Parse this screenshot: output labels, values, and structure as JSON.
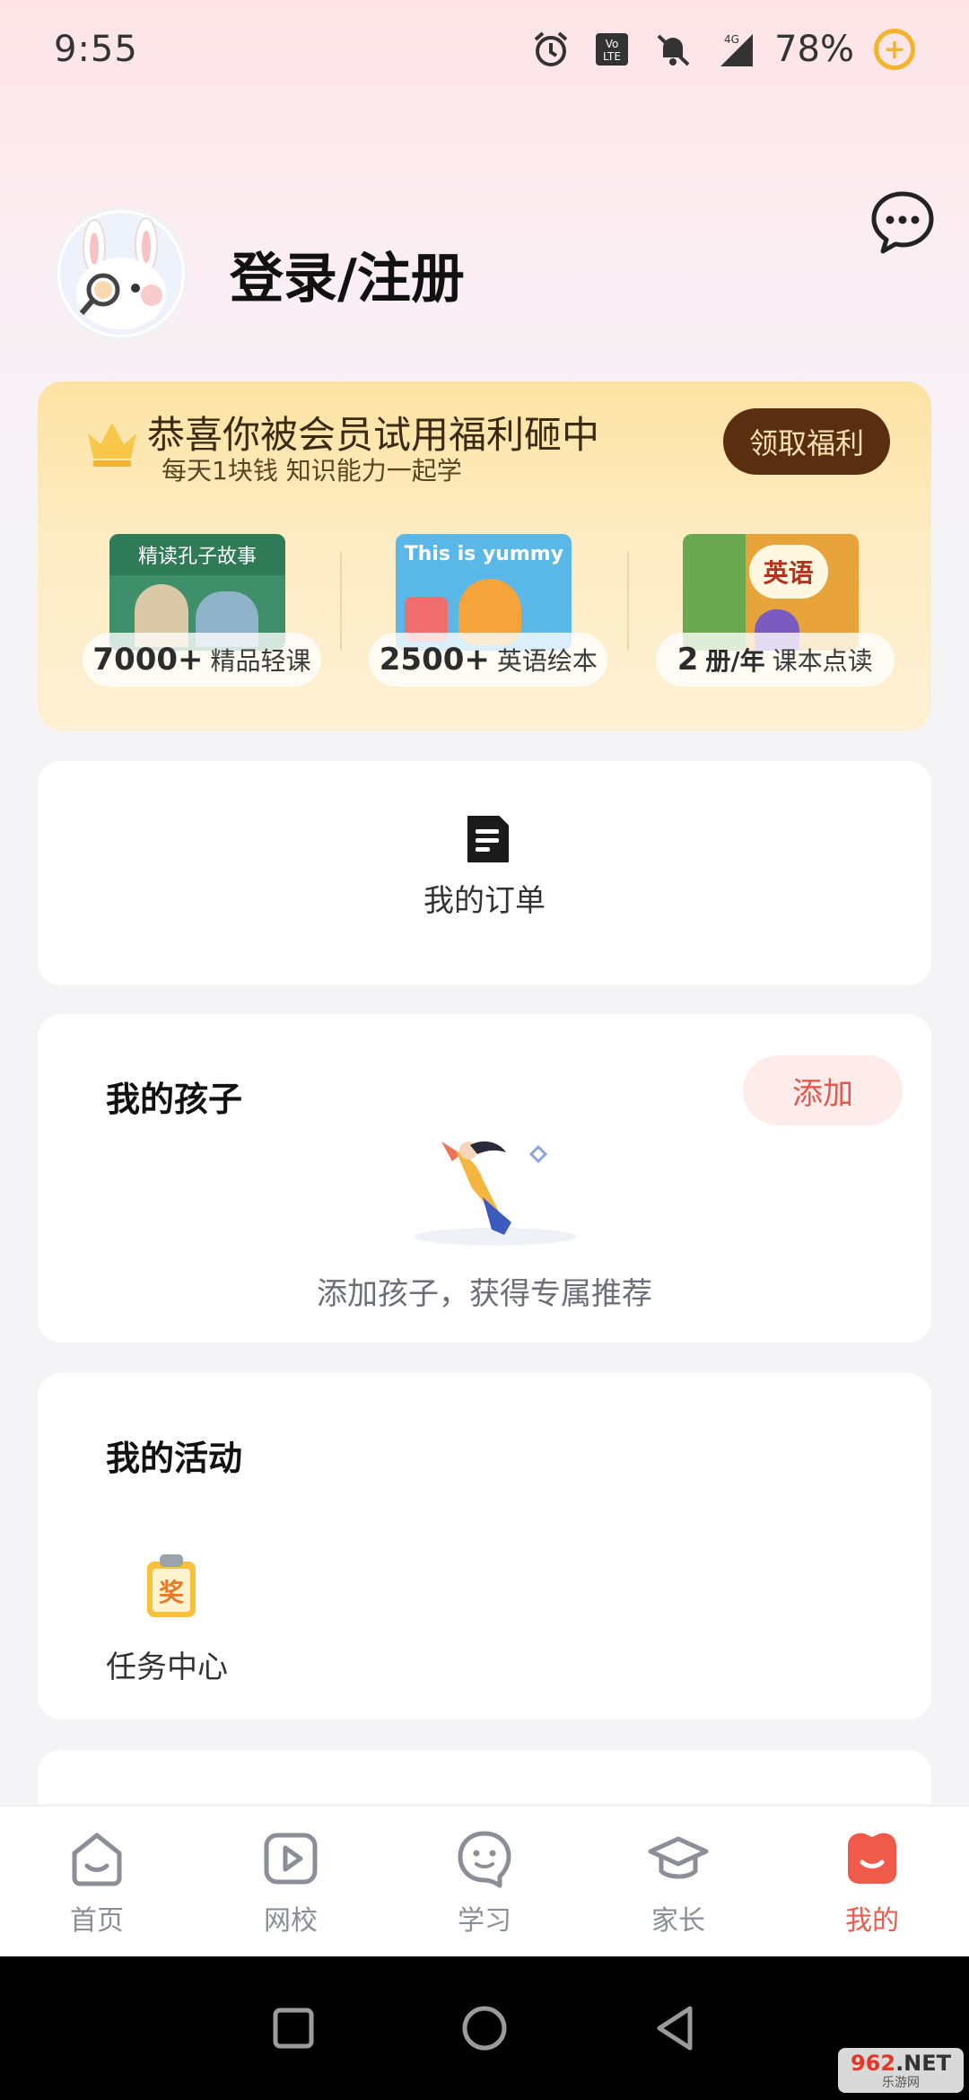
{
  "status_bar": {
    "time": "9:55",
    "battery": "78%",
    "network": "4G"
  },
  "header": {
    "login_label": "登录/注册"
  },
  "vip": {
    "title": "恭喜你被会员试用福利砸中",
    "subtitle": "每天1块钱 知识能力一起学",
    "button": "领取福利",
    "items": [
      {
        "number": "7000+",
        "label": "精品轻课",
        "cover_text": "精读孔子故事"
      },
      {
        "number": "2500+",
        "label": "英语绘本",
        "cover_text": "This is yummy"
      },
      {
        "number": "2",
        "unit": "册/年",
        "label": "课本点读",
        "cover_text": "英语"
      }
    ]
  },
  "orders": {
    "label": "我的订单"
  },
  "kids": {
    "title": "我的孩子",
    "add_button": "添加",
    "hint": "添加孩子，获得专属推荐"
  },
  "activities": {
    "title": "我的活动",
    "task_label": "任务中心",
    "task_badge": "奖"
  },
  "tabbar": {
    "items": [
      {
        "label": "首页",
        "icon": "home-icon"
      },
      {
        "label": "网校",
        "icon": "play-icon"
      },
      {
        "label": "学习",
        "icon": "study-face-icon"
      },
      {
        "label": "家长",
        "icon": "graduation-cap-icon"
      },
      {
        "label": "我的",
        "icon": "profile-icon",
        "active": true
      }
    ]
  },
  "watermark": {
    "main": "962",
    "suffix": ".NET",
    "sub": "乐游网"
  },
  "colors": {
    "accent": "#f05a4b",
    "vip_button": "#5a2e10",
    "vip_bg": "#fde3a3"
  }
}
